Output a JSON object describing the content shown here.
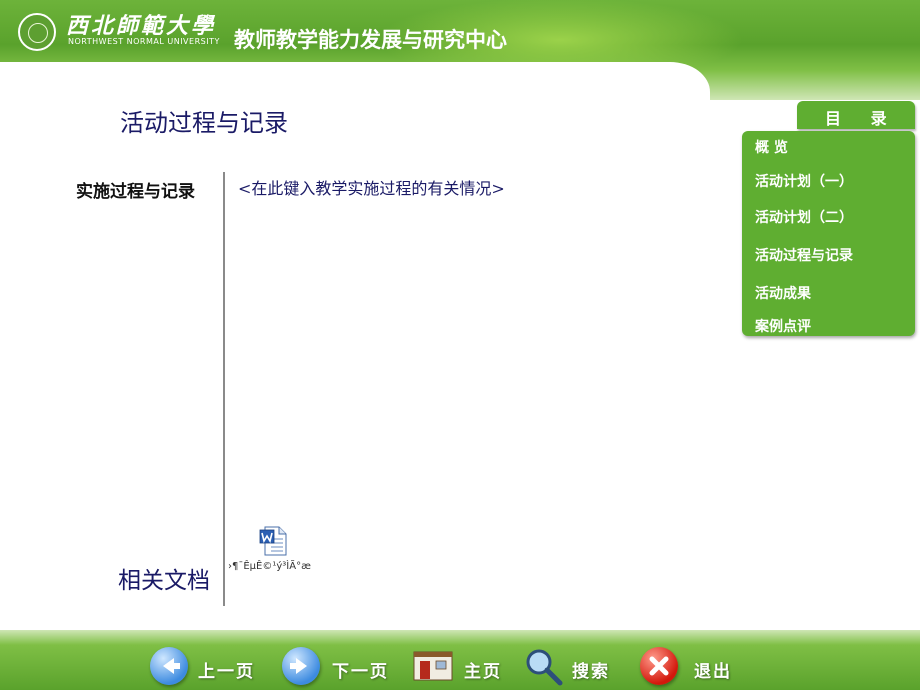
{
  "header": {
    "logo_cn": "西北師範大學",
    "logo_en": "NORTHWEST NORMAL UNIVERSITY",
    "center_title": "教师教学能力发展与研究中心"
  },
  "menu": {
    "title": "目 录",
    "items": [
      {
        "label": "概 览"
      },
      {
        "label": "活动计划（一）"
      },
      {
        "label": "活动计划（二）"
      },
      {
        "label": "活动过程与记录"
      },
      {
        "label": "活动成果"
      },
      {
        "label": "案例点评"
      }
    ]
  },
  "main": {
    "title": "活动过程与记录",
    "section_label": "实施过程与记录",
    "placeholder": "<在此键入教学实施过程的有关情况>",
    "related_label": "相关文档",
    "doc_name": "›¶¯ÊµÊ©¹ý³ÌÃ°æ"
  },
  "footer": {
    "prev": "上一页",
    "next": "下一页",
    "home": "主页",
    "search": "搜索",
    "exit": "退出"
  },
  "colors": {
    "green": "#5fae31",
    "title_navy": "#1a1a66"
  }
}
